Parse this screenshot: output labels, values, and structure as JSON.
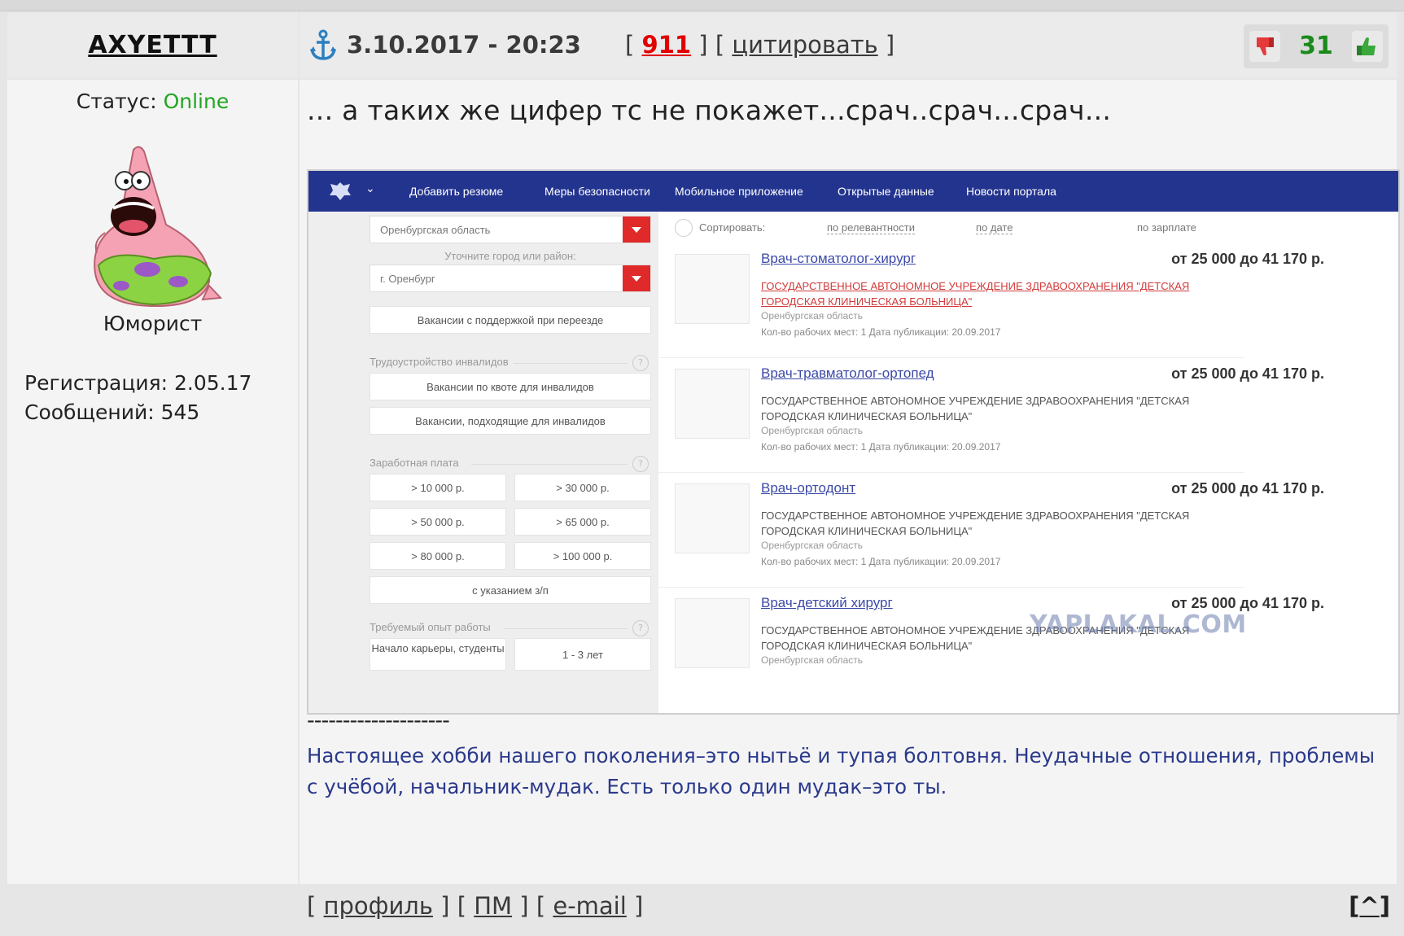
{
  "user": {
    "nickname": "AXYETTT",
    "status_label": "Статус:",
    "status_value": "Online",
    "rank": "Юморист",
    "registration": "Регистрация: 2.05.17",
    "messages": "Сообщений: 545"
  },
  "post_header": {
    "datetime": "3.10.2017 - 20:23",
    "post_number": "911",
    "quote_label": "цитировать",
    "rating": "31"
  },
  "post": {
    "text": "... а таких же цифер тс не покажет...срач..срач...срач...",
    "divider": "--------------------",
    "signature": "Настоящее хобби нашего поколения–это нытьё и тупая болтовня. Неудачные отношения, проблемы с учёбой, начальник-мудак. Есть только один мудак–это ты."
  },
  "embedded": {
    "nav": [
      "Добавить резюме",
      "Меры безопасности",
      "Мобильное приложение",
      "Открытые данные",
      "Новости портала"
    ],
    "region": "Оренбургская область",
    "city_caption": "Уточните город или район:",
    "city": "г. Оренбург",
    "relocation_btn": "Вакансии с поддержкой при переезде",
    "disabled_caption": "Трудоустройство инвалидов",
    "quota_btn": "Вакансии по квоте для инвалидов",
    "suitable_btn": "Вакансии, подходящие для инвалидов",
    "salary_caption": "Заработная плата",
    "salary_opts": [
      "> 10 000 р.",
      "> 30 000 р.",
      "> 50 000 р.",
      "> 65 000 р.",
      "> 80 000 р.",
      "> 100 000 р."
    ],
    "with_salary_btn": "с указанием з/п",
    "exp_caption": "Требуемый опыт работы",
    "exp_opts": [
      "Начало карьеры, студенты",
      "1 - 3 лет"
    ],
    "sort_label": "Сортировать:",
    "sort_opts": [
      "по релевантности",
      "по дате",
      "по зарплате"
    ],
    "org": "ГОСУДАРСТВЕННОЕ АВТОНОМНОЕ УЧРЕЖДЕНИЕ ЗДРАВООХРАНЕНИЯ \"ДЕТСКАЯ ГОРОДСКАЯ КЛИНИЧЕСКАЯ БОЛЬНИЦА\"",
    "region_small": "Оренбургская область",
    "meta": "Кол-во рабочих мест: 1   Дата публикации: 20.09.2017",
    "vacancies": [
      {
        "title": "Врач-стоматолог-хирург",
        "salary": "от 25 000 до 41 170 р."
      },
      {
        "title": "Врач-травматолог-ортопед",
        "salary": "от 25 000 до 41 170 р."
      },
      {
        "title": "Врач-ортодонт",
        "salary": "от 25 000 до 41 170 р."
      },
      {
        "title": "Врач-детский хирург",
        "salary": "от 25 000 до 41 170 р."
      }
    ],
    "watermark": "YAPLAKAL.COM"
  },
  "footer": {
    "profile": "профиль",
    "pm": "ПМ",
    "email": "e-mail",
    "to_top": "^"
  },
  "colors": {
    "online": "#22a622",
    "post_number": "#e00000",
    "rating": "#1a8a1a",
    "signature": "#2b3a8c",
    "nav_bg": "#23348f"
  }
}
